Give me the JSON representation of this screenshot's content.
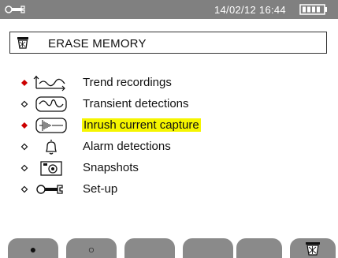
{
  "status_bar": {
    "datetime": "14/02/12 16:44"
  },
  "header": {
    "title": "ERASE MEMORY",
    "icon": "erase-bin-icon"
  },
  "memory_items": [
    {
      "label": "Trend recordings",
      "selected": true,
      "icon": "trend-icon"
    },
    {
      "label": "Transient detections",
      "selected": false,
      "icon": "transient-icon"
    },
    {
      "label": "Inrush current capture",
      "selected": true,
      "highlighted": true,
      "icon": "inrush-icon"
    },
    {
      "label": "Alarm detections",
      "selected": false,
      "icon": "alarm-bell-icon"
    },
    {
      "label": "Snapshots",
      "selected": false,
      "icon": "camera-icon"
    },
    {
      "label": "Set-up",
      "selected": false,
      "icon": "wrench-icon"
    }
  ],
  "colors": {
    "status_bg": "#808080",
    "selected_bullet": "#cc0000",
    "highlight": "#f5f500",
    "softkey_bg": "#8a8a8a"
  },
  "softkeys": {
    "k1": "●",
    "k2": "○",
    "k6": "erase-bin-icon"
  }
}
